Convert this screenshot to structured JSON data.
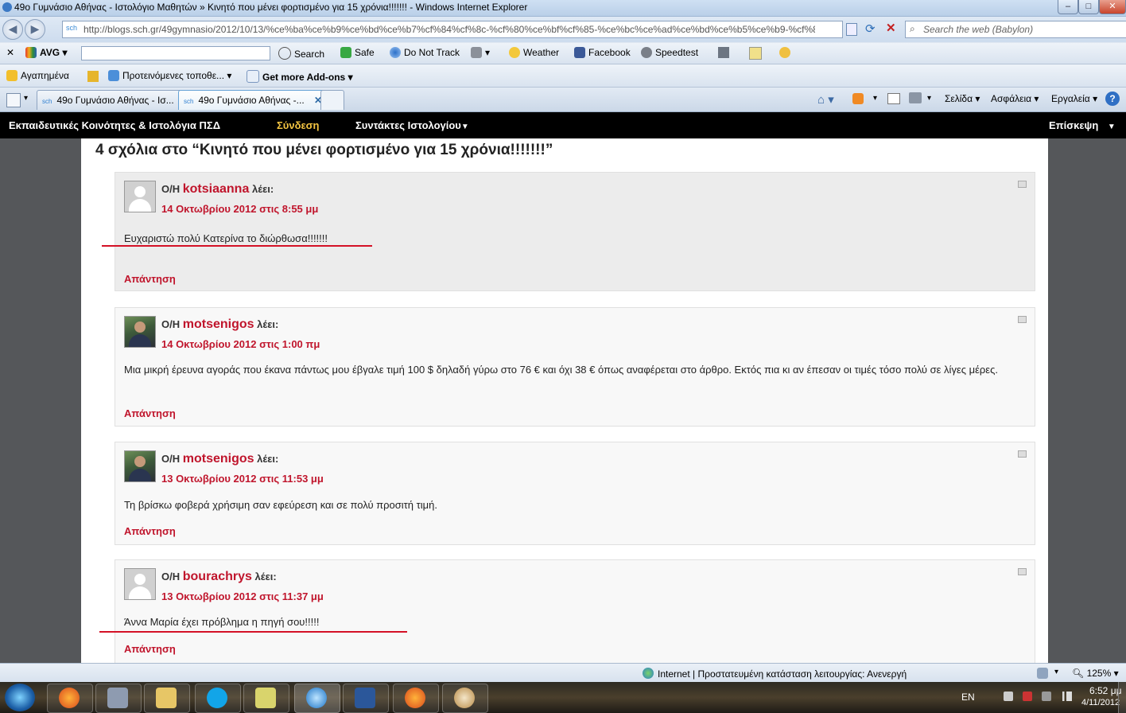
{
  "window": {
    "title": "49ο Γυμνάσιο Αθήνας - Ιστολόγιο Μαθητών » Κινητό που μένει φορτισμένο για 15 χρόνια!!!!!!! - Windows Internet Explorer",
    "min": "–",
    "max": "□",
    "close": "✕"
  },
  "address": {
    "url": "http://blogs.sch.gr/49gymnasio/2012/10/13/%ce%ba%ce%b9%ce%bd%ce%b7%cf%84%cf%8c-%cf%80%ce%bf%cf%85-%ce%bc%ce%ad%ce%bd%ce%b5%ce%b9-%cf%86%ce%bf",
    "search_placeholder": "Search the web (Babylon)",
    "back": "◀",
    "forward": "▶"
  },
  "avg_toolbar": {
    "close": "✕",
    "avg": "AVG",
    "search": "Search",
    "safe": "Safe",
    "dnt": "Do Not Track",
    "weather": "Weather",
    "facebook": "Facebook",
    "speedtest": "Speedtest"
  },
  "fav_bar": {
    "favorites": "Αγαπημένα",
    "suggested": "Προτεινόμενες τοποθε...",
    "addons": "Get more Add-ons"
  },
  "tabs": [
    {
      "label": "49ο Γυμνάσιο Αθήνας - Ισ..."
    },
    {
      "label": "49ο Γυμνάσιο Αθήνας -..."
    }
  ],
  "command_bar": {
    "page": "Σελίδα",
    "safety": "Ασφάλεια",
    "tools": "Εργαλεία",
    "help": "?"
  },
  "site_nav": {
    "brand": "Εκπαιδευτικές Κοινότητες & Ιστολόγια ΠΣΔ",
    "login": "Σύνδεση",
    "authors": "Συντάκτες Ιστολογίου",
    "visit": "Επίσκεψη"
  },
  "comments_heading": "4 σχόλια στο “Κινητό που μένει φορτισμένο για 15 χρόνια!!!!!!!”",
  "comments": [
    {
      "prefix": "Ο/Η",
      "author": "kotsiaanna",
      "says": "λέει:",
      "date": "14 Οκτωβρίου 2012 στις 8:55 μμ",
      "text": "Ευχαριστώ πολύ Κατερίνα το διώρθωσα!!!!!!!",
      "reply": "Απάντηση"
    },
    {
      "prefix": "Ο/Η",
      "author": "motsenigos",
      "says": "λέει:",
      "date": "14 Οκτωβρίου 2012 στις 1:00 πμ",
      "text": "Μια μικρή έρευνα αγοράς που έκανα πάντως μου έβγαλε τιμή 100 $ δηλαδή γύρω στο 76 € και όχι 38 € όπως αναφέρεται στο άρθρο. Εκτός πια κι αν έπεσαν οι τιμές τόσο πολύ σε λίγες μέρες.",
      "reply": "Απάντηση"
    },
    {
      "prefix": "Ο/Η",
      "author": "motsenigos",
      "says": "λέει:",
      "date": "13 Οκτωβρίου 2012 στις 11:53 μμ",
      "text": "Τη βρίσκω φοβερά χρήσιμη σαν εφεύρεση και σε πολύ προσιτή τιμή.",
      "reply": "Απάντηση"
    },
    {
      "prefix": "Ο/Η",
      "author": "bourachrys",
      "says": "λέει:",
      "date": "13 Οκτωβρίου 2012 στις 11:37 μμ",
      "text": "Άννα Μαρία έχει πρόβλημα η πηγή σου!!!!!",
      "reply": "Απάντηση"
    }
  ],
  "status_bar": {
    "zone": "Internet | Προστατευμένη κατάσταση λειτουργίας: Ανενεργή",
    "zoom": "125%"
  },
  "taskbar": {
    "lang": "EN",
    "time": "6:52 μμ",
    "date": "4/11/2012"
  },
  "colors": {
    "accent_red": "#c0152c",
    "nav_bg": "#000000",
    "login_color": "#f5c542"
  }
}
